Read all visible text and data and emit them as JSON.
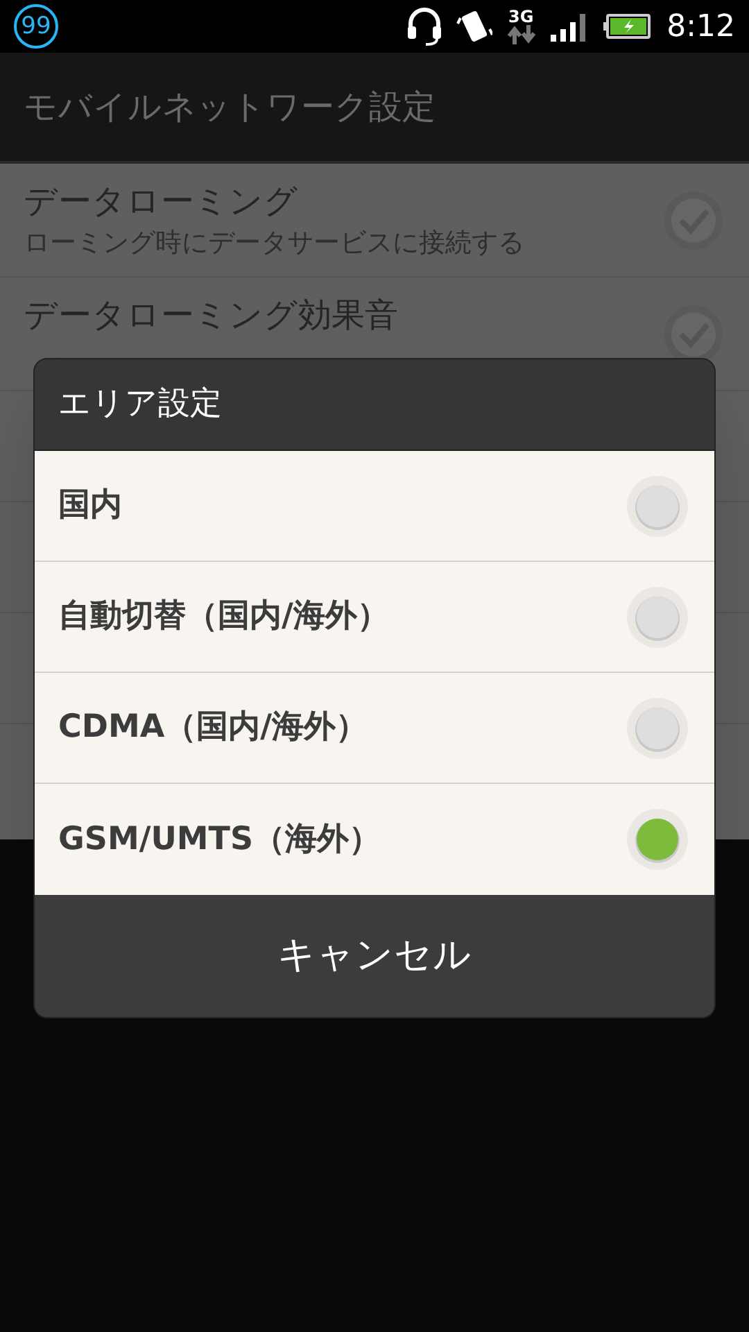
{
  "status_bar": {
    "notification_badge": "99",
    "network": "3G",
    "time": "8:12"
  },
  "title_bar": {
    "title": "モバイルネットワーク設定"
  },
  "settings": [
    {
      "title": "データローミング",
      "summary": "ローミング時にデータサービスに接続する",
      "checked": true
    },
    {
      "title": "データローミング効果音",
      "checked": true
    }
  ],
  "dialog": {
    "title": "エリア設定",
    "options": [
      {
        "label": "国内",
        "selected": false
      },
      {
        "label": "自動切替（国内/海外）",
        "selected": false
      },
      {
        "label": "CDMA（国内/海外）",
        "selected": false
      },
      {
        "label": "GSM/UMTS（海外）",
        "selected": true
      }
    ],
    "cancel_button": "キャンセル"
  }
}
